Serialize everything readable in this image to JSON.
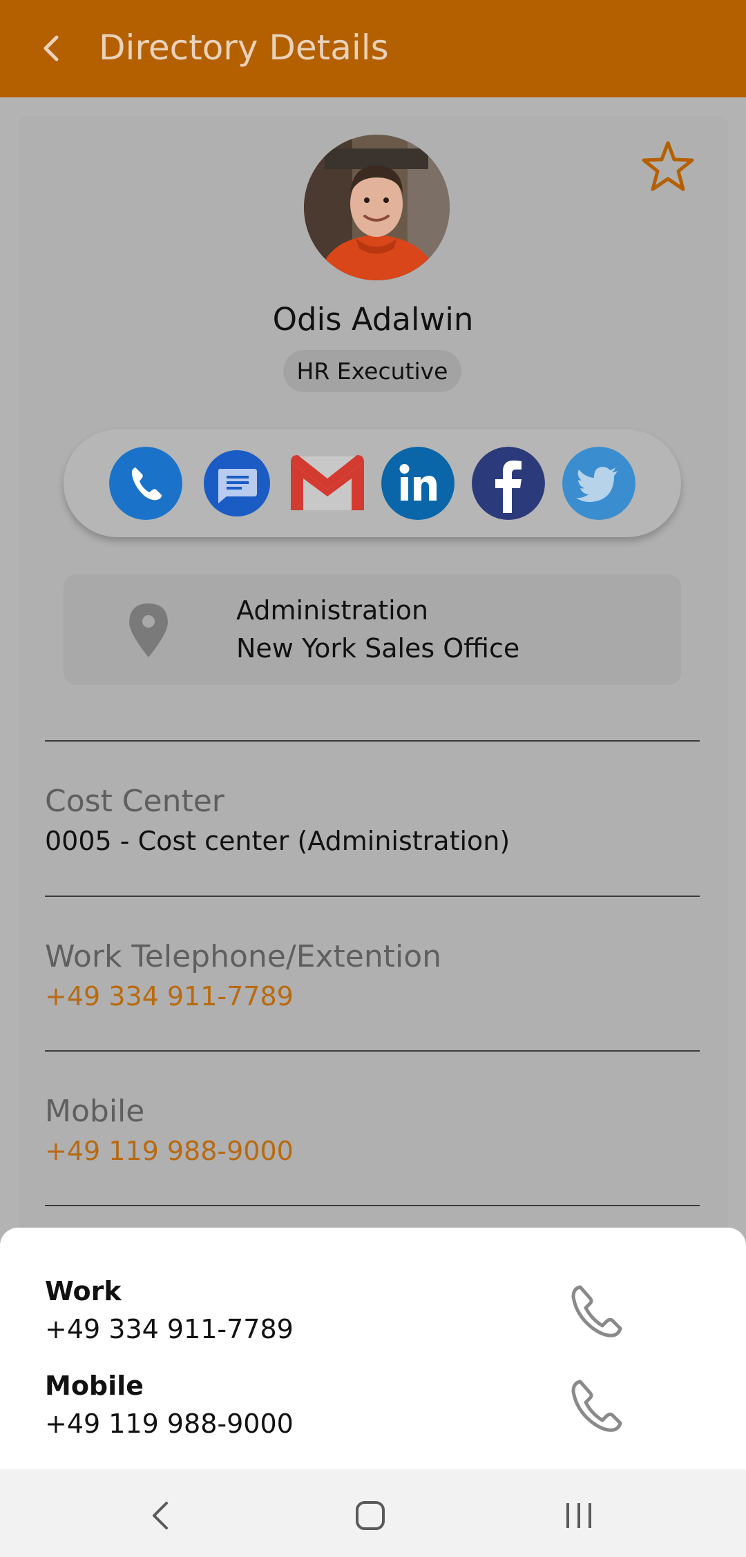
{
  "app_bar": {
    "title": "Directory Details",
    "back_icon": "back-arrow-icon",
    "color": "#b46001"
  },
  "profile": {
    "name": "Odis Adalwin",
    "role": "HR Executive",
    "favorite_icon": "star-outline-icon",
    "accent": "#b46001"
  },
  "contact_actions": [
    {
      "name": "phone",
      "icon": "phone-icon",
      "color": "#1a73c9"
    },
    {
      "name": "messages",
      "icon": "message-icon",
      "color": "#1a5bc4"
    },
    {
      "name": "gmail",
      "icon": "gmail-icon",
      "color": "#d43b30"
    },
    {
      "name": "linkedin",
      "icon": "linkedin-icon",
      "color": "#0a66a8"
    },
    {
      "name": "facebook",
      "icon": "facebook-icon",
      "color": "#2b3a7a"
    },
    {
      "name": "twitter",
      "icon": "twitter-icon",
      "color": "#3a8ecf"
    }
  ],
  "location": {
    "department": "Administration",
    "office": "New York Sales Office",
    "icon": "map-pin-icon"
  },
  "details": {
    "cost_center_label": "Cost Center",
    "cost_center_value": "0005 - Cost center (Administration)",
    "work_phone_label": "Work Telephone/Extention",
    "work_phone_value": "+49 334 911-7789",
    "mobile_label": "Mobile",
    "mobile_value": "+49 119 988-9000",
    "link_color": "#b86a12"
  },
  "call_sheet": {
    "options": [
      {
        "label": "Work",
        "number": "+49 334 911-7789",
        "icon": "phone-outline-icon"
      },
      {
        "label": "Mobile",
        "number": "+49 119 988-9000",
        "icon": "phone-outline-icon"
      }
    ]
  },
  "nav_bar": {
    "buttons": [
      "back-nav-icon",
      "home-nav-icon",
      "recents-nav-icon"
    ]
  }
}
